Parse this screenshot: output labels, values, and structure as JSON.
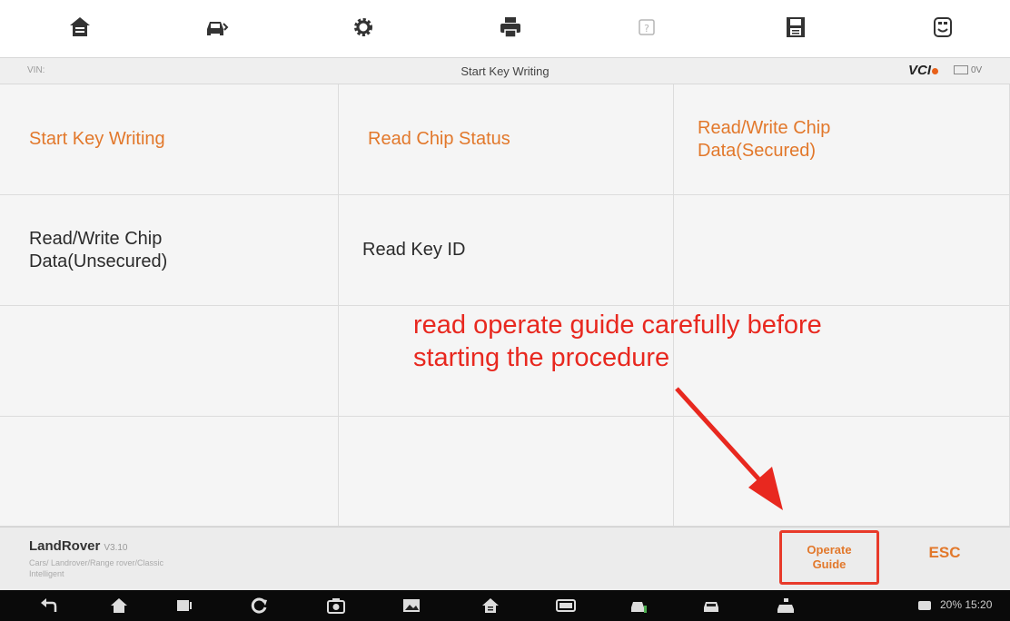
{
  "toolbar": {
    "icons": [
      "home-icon",
      "vehicle-icon",
      "settings-icon",
      "print-icon",
      "help-icon",
      "save-icon",
      "data-logging-icon"
    ]
  },
  "title_strip": {
    "vin_label": "VIN:",
    "title": "Start Key Writing",
    "vci_label": "VCI",
    "battery_label": "0V"
  },
  "menu": {
    "items": [
      "Start Key Writing",
      "Read Chip Status",
      "Read/Write Chip Data(Secured)",
      "Read/Write Chip Data(Unsecured)",
      "Read Key ID"
    ]
  },
  "annotation": {
    "line1": "read operate guide carefully before",
    "line2": "starting the procedure"
  },
  "bottom_bar": {
    "brand": "LandRover",
    "version": "V3.10",
    "path_line1": "Cars/ Landrover/Range rover/Classic",
    "path_line2": "Intelligent",
    "operate_guide_line1": "Operate",
    "operate_guide_line2": "Guide",
    "esc_label": "ESC"
  },
  "navbar": {
    "status": "20% 15:20"
  },
  "colors": {
    "accent_orange": "#e2782b",
    "annotation_red": "#e8281f",
    "highlight_box": "#e83a2a"
  }
}
